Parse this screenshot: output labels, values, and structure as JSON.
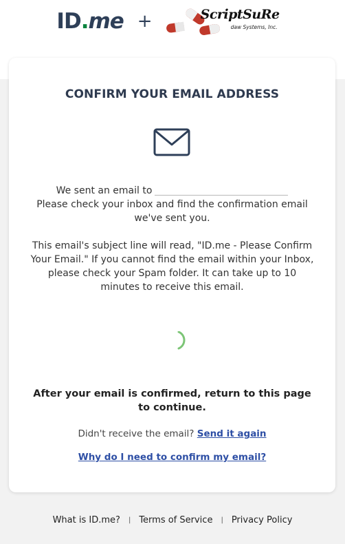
{
  "header": {
    "idme_logo": {
      "id": "ID",
      "dot": ".",
      "me": "me"
    },
    "plus": "+",
    "partner_logo": {
      "name": "ScriptSuRe",
      "subtitle": "daw Systems, Inc.",
      "rx": "x"
    }
  },
  "card": {
    "title": "CONFIRM YOUR EMAIL ADDRESS",
    "sent_text": "We sent an email to",
    "email_value": "",
    "check_text": "Please check your inbox and find the confirmation email we've sent you.",
    "subject_text": "This email's subject line will read, \"ID.me - Please Confirm Your Email.\" If you cannot find the email within your Inbox, please check your Spam folder. It can take up to 10 minutes to receive this email.",
    "after_text": "After your email is confirmed, return to this page to continue.",
    "didnt_receive": "Didn't receive the email?",
    "send_again": "Send it again",
    "why_link": "Why do I need to confirm my email?"
  },
  "footer": {
    "links": [
      "What is ID.me?",
      "Terms of Service",
      "Privacy Policy"
    ],
    "separator": "|"
  },
  "colors": {
    "brand_navy": "#2e3f58",
    "brand_green": "#08833d",
    "link_blue": "#2e4fa5",
    "spinner_green": "#7cc576",
    "pill_red": "#c0392b"
  },
  "icons": [
    "envelope-icon",
    "loading-spinner-icon"
  ]
}
